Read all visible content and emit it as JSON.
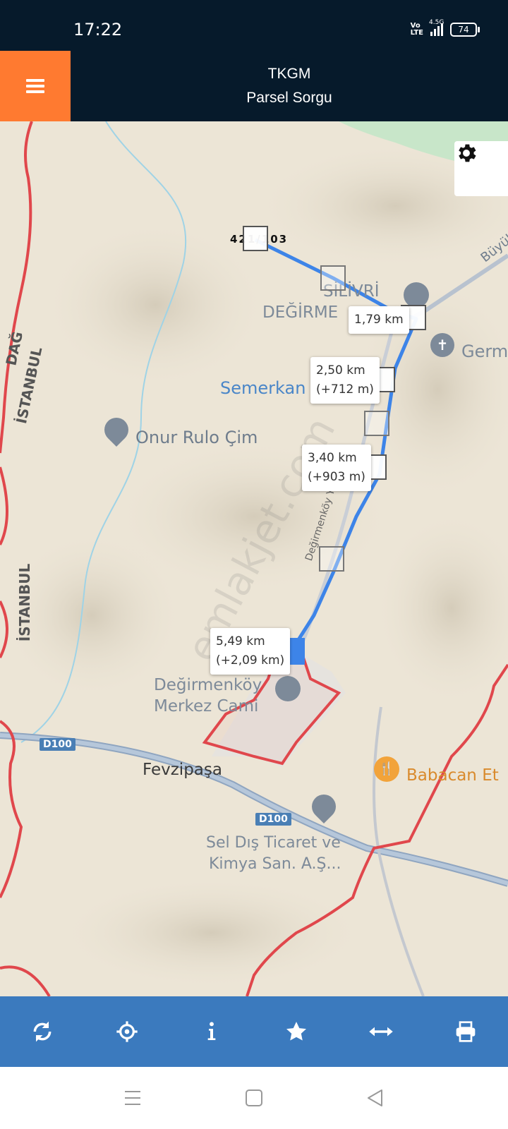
{
  "status": {
    "time": "17:22",
    "volte": "Vo\nLTE",
    "network": "4.5G",
    "battery": "74"
  },
  "header": {
    "title_line1": "TKGM",
    "title_line2": "Parsel Sorgu"
  },
  "map": {
    "parcel_label": "421/103",
    "measure": [
      {
        "line1": "1,79 km",
        "line2": ""
      },
      {
        "line1": "2,50 km",
        "line2": "(+712 m)"
      },
      {
        "line1": "3,40 km",
        "line2": "(+903 m)"
      },
      {
        "line1": "5,49 km",
        "line2": "(+2,09 km)"
      }
    ],
    "labels": {
      "silivri": "SİLİVRİ",
      "degirme": "DEĞİRME",
      "semerkan": "Semerkan",
      "onur": "Onur Rulo Çim",
      "germ": "Germ",
      "istanbul": "İSTANBUL",
      "dag": "DAĞ",
      "buyuk": "Büyük",
      "road": "Değirmenköy Yolu",
      "cami1": "Değirmenköy",
      "cami2": "Merkez Cami",
      "fevzipasa": "Fevzipaşa",
      "babacan": "Babacan Et",
      "sel1": "Sel Dış Ticaret ve",
      "sel2": "Kimya San. A.Ş...",
      "d100": "D100",
      "watermark": "emlakjet.com"
    }
  },
  "toolbar": [
    "refresh-icon",
    "locate-icon",
    "info-icon",
    "star-icon",
    "measure-icon",
    "print-icon"
  ],
  "colors": {
    "header_bg": "#061a2b",
    "menu_bg": "#ff7a30",
    "toolbar_bg": "#3b7abe",
    "route": "#3d84e8",
    "boundary": "#e0474c"
  }
}
